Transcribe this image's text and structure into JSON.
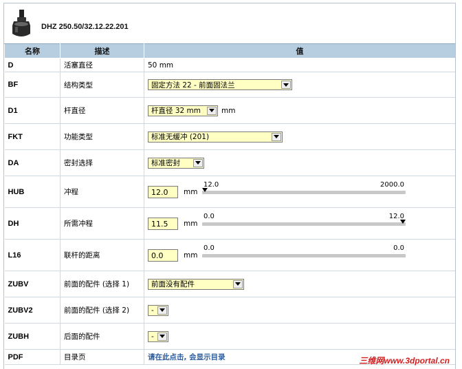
{
  "product": {
    "title": "DHZ 250.50/32.12.22.201"
  },
  "table": {
    "headers": [
      "名称",
      "描述",
      "值"
    ],
    "rows": {
      "D": {
        "name": "D",
        "desc": "活塞直径",
        "value": "50 mm"
      },
      "BF": {
        "name": "BF",
        "desc": "结构类型",
        "value": "固定方法 22 - 前面固法兰"
      },
      "D1": {
        "name": "D1",
        "desc": "杆直径",
        "value": "杆直径 32 mm",
        "unit": "mm"
      },
      "FKT": {
        "name": "FKT",
        "desc": "功能类型",
        "value": "标准无缓冲 (201)"
      },
      "DA": {
        "name": "DA",
        "desc": "密封选择",
        "value": "标准密封"
      },
      "HUB": {
        "name": "HUB",
        "desc": "冲程",
        "value": "12.0",
        "unit": "mm",
        "min": "12.0",
        "max": "2000.0"
      },
      "DH": {
        "name": "DH",
        "desc": "所需冲程",
        "value": "11.5",
        "unit": "mm",
        "min": "0.0",
        "max": "12.0"
      },
      "L16": {
        "name": "L16",
        "desc": "联杆的距离",
        "value": "0.0",
        "unit": "mm",
        "min": "0.0",
        "max": "0.0"
      },
      "ZUBV": {
        "name": "ZUBV",
        "desc": "前面的配件 (选择 1)",
        "value": "前面没有配件"
      },
      "ZUBV2": {
        "name": "ZUBV2",
        "desc": "前面的配件 (选择 2)",
        "value": "-"
      },
      "ZUBH": {
        "name": "ZUBH",
        "desc": "后面的配件",
        "value": "-"
      },
      "PDF": {
        "name": "PDF",
        "desc": "目录页",
        "value": "请在此点击, 会显示目录"
      }
    }
  },
  "slider_levels": {
    "HUB": 0.0,
    "DH": 1.0,
    "L16": 0.0
  },
  "watermark": "三维网www.3dportal.cn",
  "colors": {
    "header_bg": "#b7cee0",
    "field_bg": "#ffffc4",
    "link": "#2d5fa0",
    "watermark": "#d11f1f"
  }
}
